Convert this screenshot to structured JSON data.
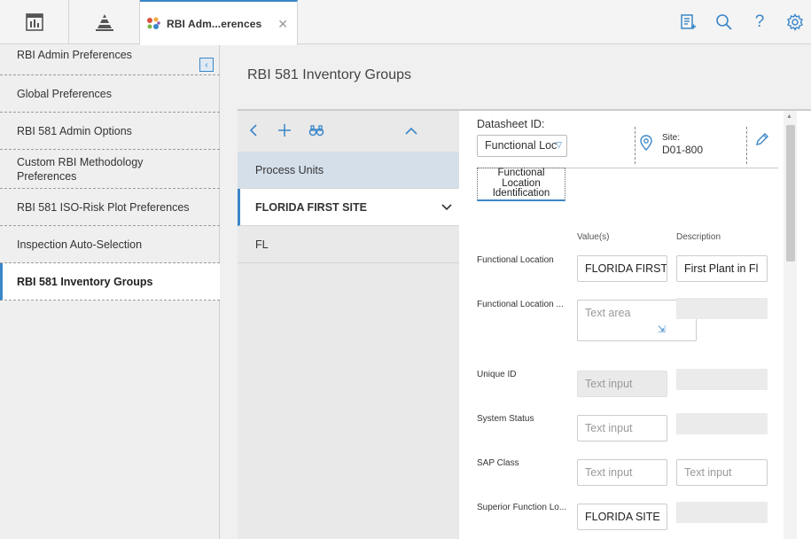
{
  "tab": {
    "title": "RBI Adm...erences"
  },
  "left_nav": {
    "items": [
      {
        "label": "RBI Admin Preferences"
      },
      {
        "label": "Global Preferences"
      },
      {
        "label": "RBI 581 Admin Options"
      },
      {
        "label": "Custom RBI Methodology Preferences"
      },
      {
        "label": "RBI 581 ISO-Risk Plot Preferences"
      },
      {
        "label": "Inspection Auto-Selection"
      },
      {
        "label": "RBI 581 Inventory Groups"
      }
    ]
  },
  "main": {
    "title": "RBI 581 Inventory Groups"
  },
  "tree": {
    "rows": [
      {
        "label": "Process Units"
      },
      {
        "label": "FLORIDA FIRST SITE"
      },
      {
        "label": "FL"
      }
    ]
  },
  "datasheet": {
    "id_label": "Datasheet ID:",
    "id_value": "Functional Loc",
    "site_label": "Site:",
    "site_value": "D01-800",
    "subtab_label": "Functional Location Identification",
    "col_values": "Value(s)",
    "col_description": "Description",
    "fields": [
      {
        "label": "Functional Location",
        "value": "FLORIDA FIRST",
        "description": "First Plant in Fl"
      },
      {
        "label": "Functional Location ...",
        "placeholder": "Text area"
      },
      {
        "label": "Unique ID",
        "placeholder": "Text input"
      },
      {
        "label": "System Status",
        "placeholder": "Text input"
      },
      {
        "label": "SAP Class",
        "placeholder": "Text input",
        "description_placeholder": "Text input"
      },
      {
        "label": "Superior Function Lo...",
        "value": "FLORIDA SITE"
      }
    ]
  },
  "colors": {
    "accent": "#3a86c8",
    "selected_row_bg": "#d5dfea"
  }
}
